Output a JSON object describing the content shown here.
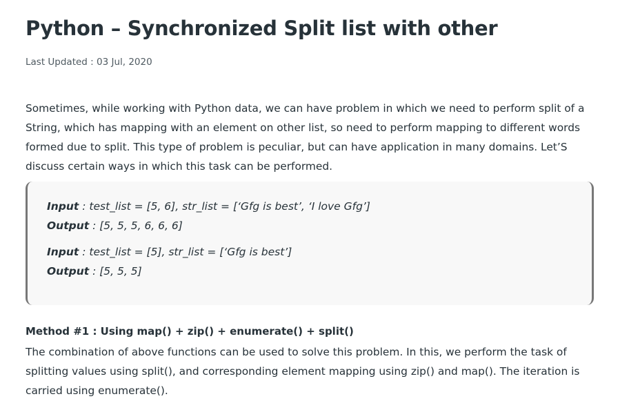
{
  "article": {
    "title": "Python – Synchronized Split list with other",
    "last_updated": "Last Updated : 03 Jul, 2020",
    "intro": "Sometimes, while working with Python data, we can have problem in which we need to perform split of a String, which has mapping with an element on other list, so need to perform mapping to different words formed due to split. This type of problem is peculiar, but can have application in many domains. Let’S discuss certain ways in which this task can be performed."
  },
  "examples": [
    {
      "input_label": "Input",
      "input_value": " : test_list = [5, 6], str_list = [‘Gfg is best’, ‘I love Gfg’]",
      "output_label": "Output",
      "output_value": " : [5, 5, 5, 6, 6, 6]"
    },
    {
      "input_label": "Input",
      "input_value": " : test_list = [5], str_list = [‘Gfg is best’]",
      "output_label": "Output",
      "output_value": " : [5, 5, 5]"
    }
  ],
  "method": {
    "heading": "Method #1 : Using map() + zip() + enumerate() + split()",
    "body": "The combination of above functions can be used to solve this problem. In this, we perform the task of splitting values using split(), and corresponding element mapping using zip() and map(). The iteration is carried using enumerate()."
  }
}
